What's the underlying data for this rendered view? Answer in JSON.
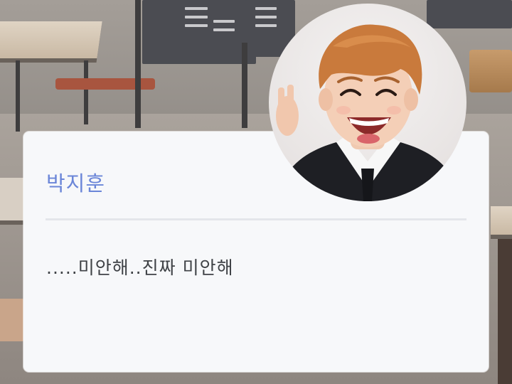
{
  "dialogue": {
    "speaker_name": "박지훈",
    "text": ".....미안해..진짜 미안해"
  },
  "colors": {
    "speaker_name": "#6b86d8",
    "text": "#3f4246",
    "card_background": "#f7f8fa",
    "divider": "#e4e6ea"
  },
  "icons": {
    "avatar": "character-portrait"
  }
}
